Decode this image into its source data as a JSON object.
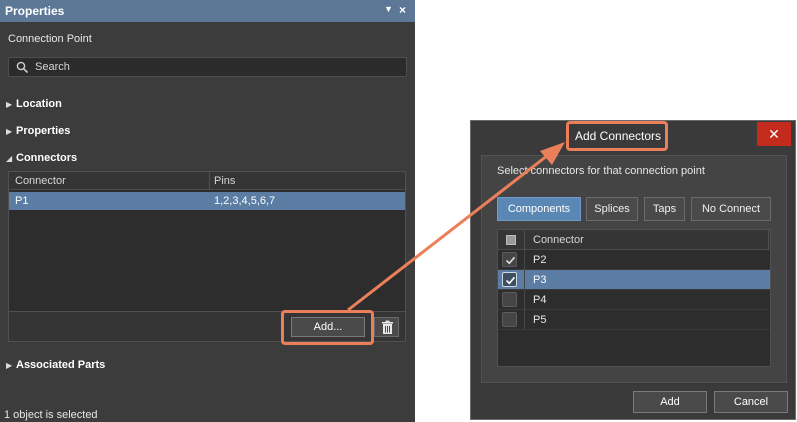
{
  "properties_panel": {
    "title": "Properties",
    "object_type": "Connection Point",
    "search": {
      "placeholder": "Search"
    },
    "sections": {
      "location": "Location",
      "properties": "Properties",
      "connectors": "Connectors",
      "associated_parts": "Associated Parts"
    },
    "connectors_table": {
      "columns": [
        "Connector",
        "Pins"
      ],
      "rows": [
        {
          "connector": "P1",
          "pins": "1,2,3,4,5,6,7",
          "selected": true
        }
      ]
    },
    "add_button": "Add...",
    "status": "1 object is selected"
  },
  "dialog": {
    "title": "Add Connectors",
    "close_glyph": "✕",
    "description": "Select connectors for that connection point",
    "tabs": [
      {
        "label": "Components",
        "active": true
      },
      {
        "label": "Splices",
        "active": false
      },
      {
        "label": "Taps",
        "active": false
      },
      {
        "label": "No Connect",
        "active": false
      }
    ],
    "list_header": "Connector",
    "items": [
      {
        "label": "P2",
        "checked": true,
        "selected": false
      },
      {
        "label": "P3",
        "checked": true,
        "selected": true
      },
      {
        "label": "P4",
        "checked": false,
        "selected": false
      },
      {
        "label": "P5",
        "checked": false,
        "selected": false
      }
    ],
    "add_button": "Add",
    "cancel_button": "Cancel"
  },
  "colors": {
    "panel_bg": "#3c3c3c",
    "title_bar": "#5c7896",
    "selection": "#5b7da3",
    "active_tab": "#5b87b5",
    "highlight": "#ea7f5a",
    "close_button": "#c42b1c"
  },
  "icons": [
    "search-icon",
    "pin-icon",
    "close-icon",
    "trash-icon",
    "check-icon",
    "collapsed-arrow-icon",
    "expanded-arrow-icon"
  ]
}
